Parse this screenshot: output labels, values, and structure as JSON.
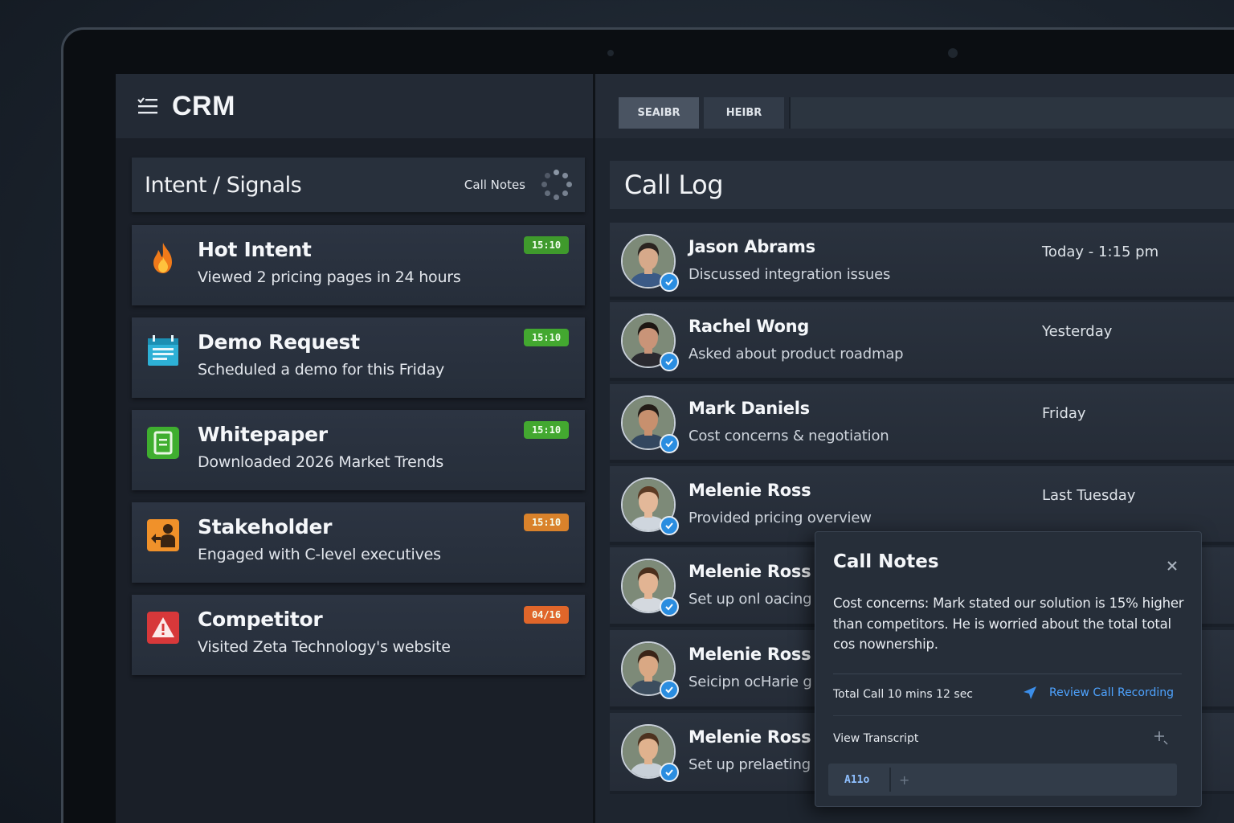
{
  "app": {
    "title": "CRM"
  },
  "left": {
    "header_title": "Intent / Signals",
    "header_link": "Call Notes",
    "signals": [
      {
        "title": "Hot Intent",
        "subtitle": "Viewed 2 pricing pages in 24 hours",
        "badge": "15:10",
        "badge_color": "#3f9a2c",
        "icon": "fire-icon"
      },
      {
        "title": "Demo Request",
        "subtitle": "Scheduled a demo for this Friday",
        "badge": "15:10",
        "badge_color": "#43a830",
        "icon": "calendar-icon"
      },
      {
        "title": "Whitepaper",
        "subtitle": "Downloaded 2026 Market Trends",
        "badge": "15:10",
        "badge_color": "#43a830",
        "icon": "document-icon"
      },
      {
        "title": "Stakeholder",
        "subtitle": "Engaged with C-level executives",
        "badge": "15:10",
        "badge_color": "#d9822b",
        "icon": "people-icon"
      },
      {
        "title": "Competitor",
        "subtitle": "Visited Zeta Technology's website",
        "badge": "04/16",
        "badge_color": "#e0662a",
        "icon": "warning-icon"
      }
    ]
  },
  "right": {
    "tabs": [
      {
        "label": "SEAIBR"
      },
      {
        "label": "HEIBR"
      }
    ],
    "calllog_title": "Call Log",
    "calls": [
      {
        "name": "Jason Abrams",
        "summary": "Discussed integration issues",
        "time": "Today - 1:15 pm"
      },
      {
        "name": "Rachel Wong",
        "summary": "Asked about product roadmap",
        "time": "Yesterday"
      },
      {
        "name": "Mark Daniels",
        "summary": "Cost concerns & negotiation",
        "time": "Friday"
      },
      {
        "name": "Melenie Ross",
        "summary": "Provided pricing overview",
        "time": "Last Tuesday"
      },
      {
        "name": "Melenie Ross",
        "summary": "Set up onl oacing",
        "time": ""
      },
      {
        "name": "Melenie Ross",
        "summary": "Seicipn ocHarie g",
        "time": ""
      },
      {
        "name": "Melenie Ross",
        "summary": "Set up prelaeting",
        "time": ""
      }
    ]
  },
  "notes": {
    "title": "Call Notes",
    "body": "Cost concerns: Mark stated our solution is 15% higher than competitors. He is worried about the total total cos nownership.",
    "total_call": "Total Call 10 mins 12 sec",
    "review": "Review Call Recording",
    "transcript": "View Transcript",
    "input_label": "A11o"
  },
  "colors": {
    "accent": "#4ea3ff",
    "verified": "#2a8de0"
  }
}
